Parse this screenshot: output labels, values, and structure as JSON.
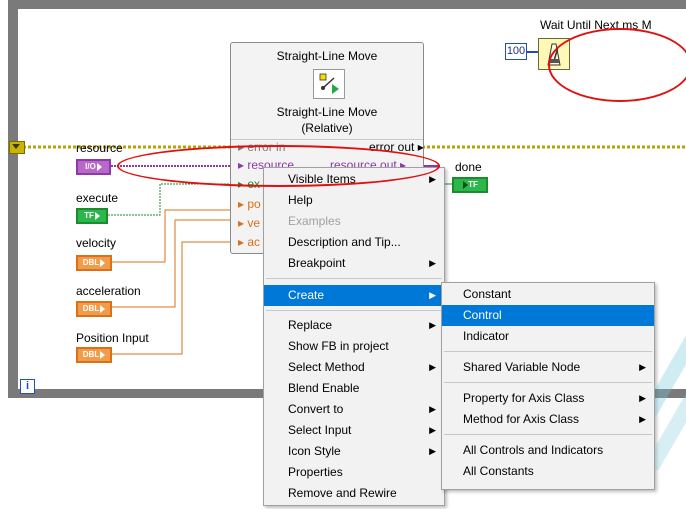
{
  "loop": {
    "iteration_terminal": "i"
  },
  "wait": {
    "label": "Wait Until Next ms M",
    "constant": "100"
  },
  "node": {
    "title": "Straight-Line Move",
    "subtitle_line1": "Straight-Line Move",
    "subtitle_line2": "(Relative)",
    "terminals_left": [
      "error in",
      "resource",
      "ex",
      "po",
      "ve",
      "ac"
    ],
    "terminals_right": [
      "error out",
      "resource out"
    ]
  },
  "controls": {
    "resource": {
      "label": "resource",
      "type": "I/O"
    },
    "execute": {
      "label": "execute",
      "type": "TF"
    },
    "velocity": {
      "label": "velocity",
      "type": "DBL"
    },
    "acceleration": {
      "label": "acceleration",
      "type": "DBL"
    },
    "position": {
      "label": "Position Input",
      "type": "DBL"
    }
  },
  "indicators": {
    "done": {
      "label": "done",
      "type": "TF"
    }
  },
  "context_menu": {
    "items": [
      {
        "label": "Visible Items",
        "submenu": true
      },
      {
        "label": "Help"
      },
      {
        "label": "Examples",
        "disabled": true
      },
      {
        "label": "Description and Tip..."
      },
      {
        "label": "Breakpoint",
        "submenu": true
      },
      {
        "label": "Create",
        "submenu": true,
        "highlighted": true
      },
      {
        "label": "Replace",
        "submenu": true
      },
      {
        "label": "Show FB in project"
      },
      {
        "label": "Select Method",
        "submenu": true
      },
      {
        "label": "Blend Enable"
      },
      {
        "label": "Convert to",
        "submenu": true
      },
      {
        "label": "Select Input",
        "submenu": true
      },
      {
        "label": "Icon Style",
        "submenu": true
      },
      {
        "label": "Properties"
      },
      {
        "label": "Remove and Rewire"
      }
    ]
  },
  "create_submenu": {
    "items": [
      {
        "label": "Constant"
      },
      {
        "label": "Control",
        "highlighted": true
      },
      {
        "label": "Indicator"
      },
      {
        "label": "Shared Variable Node",
        "submenu": true
      },
      {
        "label": "Property for Axis Class",
        "submenu": true
      },
      {
        "label": "Method for Axis Class",
        "submenu": true
      },
      {
        "label": "All Controls and Indicators"
      },
      {
        "label": "All Constants"
      }
    ]
  },
  "colors": {
    "highlight": "#0078d7",
    "annotation": "#e01010",
    "io_wire": "#8c3aa6",
    "bool_wire": "#1c8a2f",
    "dbl_wire": "#d9701a",
    "error_wire": "#b8a200"
  }
}
